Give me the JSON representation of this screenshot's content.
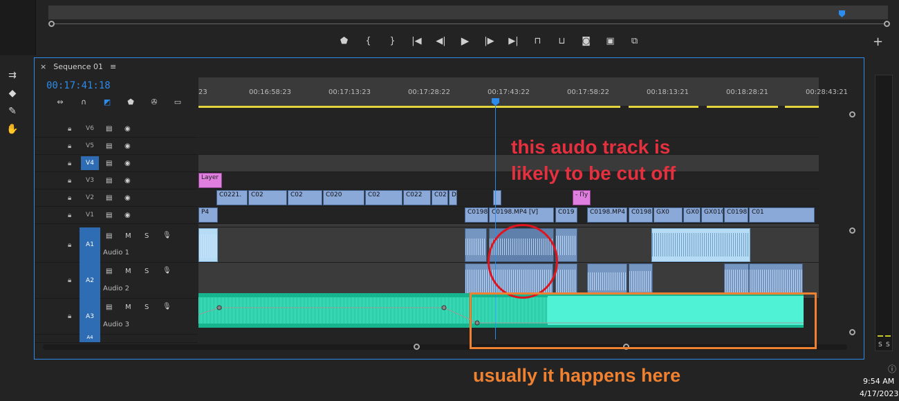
{
  "sequence": {
    "tab_close": "×",
    "tab_name": "Sequence 01",
    "tab_menu": "≡",
    "timecode": "00:17:41:18"
  },
  "ruler": {
    "ticks": [
      "23",
      "00:16:58:23",
      "00:17:13:23",
      "00:17:28:22",
      "00:17:43:22",
      "00:17:58:22",
      "00:18:13:21",
      "00:18:28:21",
      "00:28:43:21"
    ]
  },
  "transport": {
    "buttons": [
      "marker-icon",
      "in-point-icon",
      "out-point-icon",
      "go-to-in-icon",
      "step-back-icon",
      "play-icon",
      "step-forward-icon",
      "go-to-out-icon",
      "lift-icon",
      "extract-icon",
      "camera-icon",
      "compare-icon",
      "toggle-proxies-icon"
    ],
    "add": "+"
  },
  "video_tracks": [
    {
      "name": "V6",
      "targeted": false
    },
    {
      "name": "V5",
      "targeted": false
    },
    {
      "name": "V4",
      "targeted": true
    },
    {
      "name": "V3",
      "targeted": false
    },
    {
      "name": "V2",
      "targeted": false
    },
    {
      "name": "V1",
      "targeted": false
    }
  ],
  "audio_tracks": [
    {
      "id": "A1",
      "name": "Audio 1"
    },
    {
      "id": "A2",
      "name": "Audio 2"
    },
    {
      "id": "A3",
      "name": "Audio 3"
    },
    {
      "id": "A4",
      "name": ""
    }
  ],
  "track_buttons": {
    "mute": "M",
    "solo": "S"
  },
  "clips": {
    "v3": [
      {
        "label": "Layer"
      },
      {
        "label": "- Пу"
      }
    ],
    "v2": [
      {
        "label": "C0221."
      },
      {
        "label": "C02"
      },
      {
        "label": "C02"
      },
      {
        "label": "C020"
      },
      {
        "label": "C02"
      },
      {
        "label": "C022"
      },
      {
        "label": "C02"
      },
      {
        "label": "Di"
      }
    ],
    "v1": [
      {
        "label": "P4"
      },
      {
        "label": "C0198"
      },
      {
        "label": "C0198.MP4 [V]"
      },
      {
        "label": "C019"
      },
      {
        "label": "C0198.MP4"
      },
      {
        "label": "C0198."
      },
      {
        "label": "GX0"
      },
      {
        "label": "GX0"
      },
      {
        "label": "GX010"
      },
      {
        "label": "C0198"
      },
      {
        "label": "C01"
      }
    ]
  },
  "meters": {
    "left": "S",
    "right": "S"
  },
  "annotations": {
    "red_line1": "this audo track is",
    "red_line2": "likely to be cut off",
    "orange": "usually it happens here"
  },
  "taskbar": {
    "info_icon": "ⓘ",
    "time": "9:54 AM",
    "date": "4/17/2023"
  },
  "colors": {
    "accent": "#2d8ceb",
    "annotation_red": "#e5313f",
    "annotation_orange": "#f08131",
    "audio3": "#17b58f"
  }
}
